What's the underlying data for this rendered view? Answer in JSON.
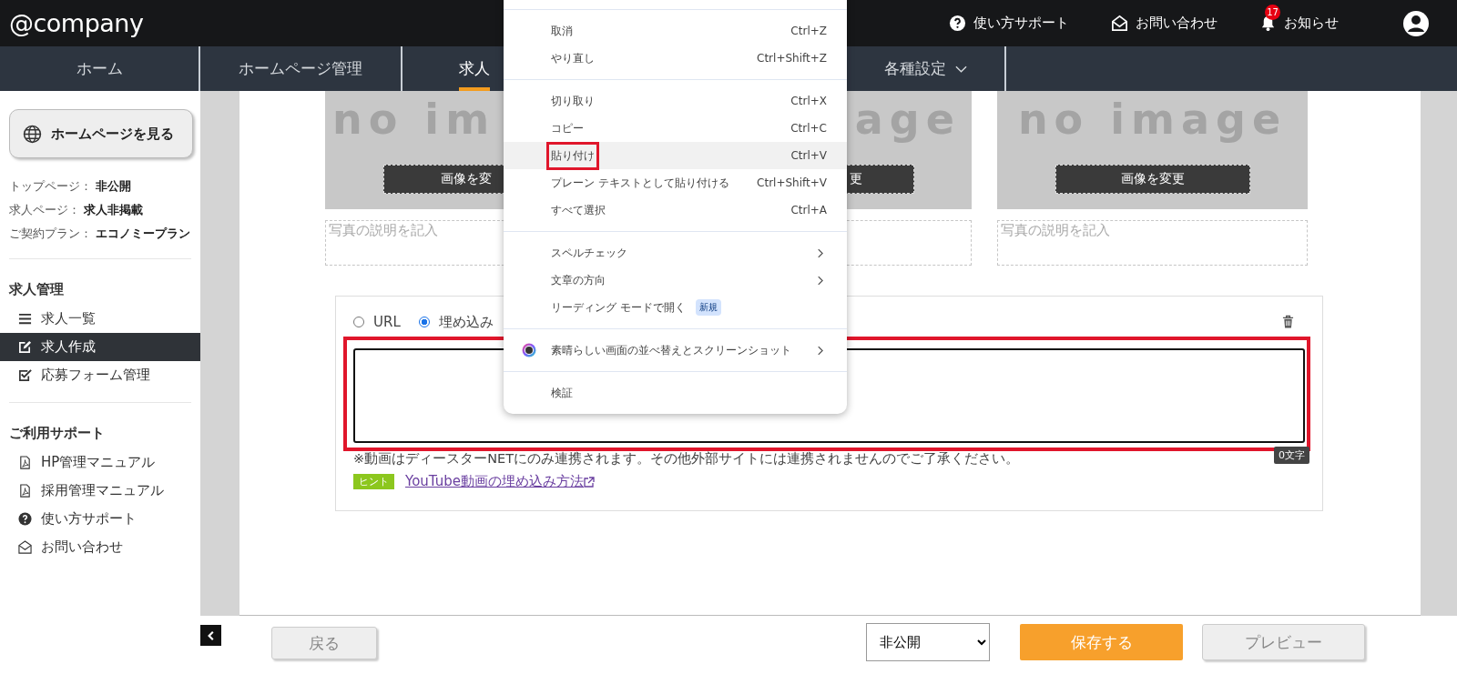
{
  "header": {
    "logo": "@company",
    "links": [
      {
        "kind": "help",
        "label": "使い方サポート"
      },
      {
        "kind": "mail",
        "label": "お問い合わせ"
      },
      {
        "kind": "bell",
        "label": "お知らせ",
        "badge": "17"
      }
    ]
  },
  "nav": [
    {
      "label": "ホーム",
      "selected": false,
      "dropdown": false
    },
    {
      "label": "ホームページ管理",
      "selected": false,
      "dropdown": false
    },
    {
      "label": "求人",
      "selected": true,
      "dropdown": false
    },
    {
      "label": "各種設定",
      "selected": false,
      "dropdown": true
    }
  ],
  "sidebar": {
    "view_button": "ホームページを見る",
    "status": [
      {
        "label": "トップページ：",
        "value": "非公開"
      },
      {
        "label": "求人ページ：",
        "value": "求人非掲載"
      },
      {
        "label": "ご契約プラン：",
        "value": "エコノミープラン"
      }
    ],
    "sections": [
      {
        "title": "求人管理",
        "items": [
          {
            "kind": "list",
            "label": "求人一覧",
            "selected": false
          },
          {
            "kind": "edit",
            "label": "求人作成",
            "selected": true
          },
          {
            "kind": "check",
            "label": "応募フォーム管理",
            "selected": false
          }
        ]
      },
      {
        "title": "ご利用サポート",
        "items": [
          {
            "kind": "pdf",
            "label": "HP管理マニュアル",
            "selected": false
          },
          {
            "kind": "pdf",
            "label": "採用管理マニュアル",
            "selected": false
          },
          {
            "kind": "help",
            "label": "使い方サポート",
            "selected": false
          },
          {
            "kind": "mail",
            "label": "お問い合わせ",
            "selected": false
          }
        ]
      }
    ]
  },
  "photos": [
    {
      "image_text": "no im",
      "button": "画像を変",
      "placeholder": "写真の説明を記入"
    },
    {
      "image_text": "age",
      "button": "更"
    },
    {
      "image_text": "no image",
      "button": "画像を変更",
      "placeholder": "写真の説明を記入"
    }
  ],
  "embed": {
    "options": [
      {
        "label": "URL",
        "selected": false
      },
      {
        "label": "埋め込み",
        "selected": true
      }
    ],
    "textarea_highlighted": true,
    "counter": "0文字",
    "note": "※動画はディースターNETにのみ連携されます。その他外部サイトには連携されませんのでご了承ください。",
    "hint_badge": "ヒント",
    "hint_link": "YouTube動画の埋め込み方法"
  },
  "context_menu": {
    "groups": [
      [
        {
          "kind": "shortcut",
          "label": "取消",
          "shortcut": "Ctrl+Z",
          "highlighted": false,
          "annotated": false
        },
        {
          "kind": "shortcut",
          "label": "やり直し",
          "shortcut": "Ctrl+Shift+Z",
          "highlighted": false,
          "annotated": false
        }
      ],
      [
        {
          "kind": "shortcut",
          "label": "切り取り",
          "shortcut": "Ctrl+X",
          "highlighted": false,
          "annotated": false
        },
        {
          "kind": "shortcut",
          "label": "コピー",
          "shortcut": "Ctrl+C",
          "highlighted": false,
          "annotated": false
        },
        {
          "kind": "shortcut",
          "label": "貼り付け",
          "shortcut": "Ctrl+V",
          "highlighted": true,
          "annotated": true
        },
        {
          "kind": "shortcut",
          "label": "プレーン テキストとして貼り付ける",
          "shortcut": "Ctrl+Shift+V",
          "highlighted": false,
          "annotated": false
        },
        {
          "kind": "shortcut",
          "label": "すべて選択",
          "shortcut": "Ctrl+A",
          "highlighted": false,
          "annotated": false
        }
      ],
      [
        {
          "kind": "submenu",
          "label": "スペルチェック",
          "highlighted": false,
          "annotated": false
        },
        {
          "kind": "submenu",
          "label": "文章の方向",
          "highlighted": false,
          "annotated": false
        },
        {
          "kind": "badge",
          "label": "リーディング モードで開く",
          "badge": "新規",
          "highlighted": false,
          "annotated": false
        }
      ],
      [
        {
          "kind": "app",
          "label": "素晴らしい画面の並べ替えとスクリーンショット",
          "highlighted": false,
          "annotated": false
        }
      ],
      [
        {
          "kind": "plain",
          "label": "検証",
          "highlighted": false,
          "annotated": false
        }
      ]
    ]
  },
  "footer": {
    "back": "戻る",
    "status_select": "非公開",
    "save": "保存する",
    "preview": "プレビュー"
  }
}
